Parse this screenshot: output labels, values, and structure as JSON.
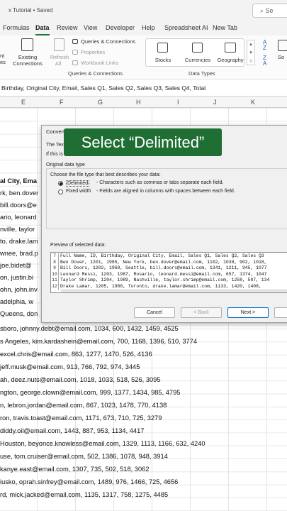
{
  "titlebar": {
    "title": "x Tutorial • Saved",
    "search_label": "Se"
  },
  "ribbon_tabs": [
    "Formulas",
    "Data",
    "Review",
    "View",
    "Developer",
    "Help",
    "Spreadsheet AI",
    "New Tab"
  ],
  "active_tab": "Data",
  "ribbon": {
    "left_cut_1": "nt",
    "left_cut_2": "es",
    "existing_connections": [
      "Existing",
      "Connections"
    ],
    "refresh": [
      "Refresh",
      "All"
    ],
    "queries_connections": "Queries & Connections",
    "properties": "Properties",
    "workbook_links": "Workbook Links",
    "group_queries": "Queries & Connections",
    "stocks": "Stocks",
    "currencies": "Currencies",
    "geography": "Geography",
    "group_datatypes": "Data Types",
    "sort_cut": "So"
  },
  "formula_bar": "Birthday,  Original City,  Email,  Sales Q1,  Sales Q2,  Sales Q3,  Sales Q4, Total",
  "column_headers": [
    "E",
    "F",
    "G",
    "H",
    "I",
    "J",
    "K"
  ],
  "rows": [
    "al City,  Ema",
    "rk, ben.dover",
    "bill.doors@e",
    "ario, leonard",
    "nville, taylor",
    "to, drake.lam",
    "wnee, brad.p",
    "joe.bidet@",
    "on, justin.bi",
    "ohn, john.inv",
    "adelphia, w",
    "Queens, don",
    "sboro, johnny.debt@email.com, 1034, 600, 1432, 1459, 4525",
    "s Angeles, kim.kardashein@email.com, 700, 1168, 1396, 510, 3774",
    "excel.chris@email.com, 863, 1277, 1470, 526, 4136",
    "jeff.musk@email.com, 913, 766, 792, 974, 3445",
    "ah, deez.nuts@email.com, 1018, 1033, 518, 526, 3095",
    "ngton, george.clown@email.com, 999, 1377, 1434, 985, 4795",
    "n, lebron.jordan@email.com, 867, 1023, 1478, 770, 4138",
    "ron, travis.toast@email.com, 1171, 673, 710, 725, 3279",
    "diddy.oil@email.com, 1443, 887, 953, 1134, 4417",
    "Houston, beyonce.knowless@email.com, 1329, 1113, 1166, 632, 4240",
    "use, tom.cruiser@email.com, 502, 1386, 1078, 948, 3914",
    "kanye.east@email.com, 1307, 735, 502, 518, 3062",
    "iusko, oprah.sinfrey@email.com, 1489, 976, 1466, 725, 4656",
    "rd, mick.jacked@email.com, 1135, 1317, 758, 1275, 4485"
  ],
  "dialog": {
    "title": "Convert",
    "line1": "The Text",
    "line2": "If this is c",
    "section": "Original data type",
    "choose_label": "Choose the file type that best describes your data:",
    "delimited_label": "Delimited",
    "delimited_desc": "- Characters such as commas or tabs separate each field.",
    "fixed_label": "Fixed width",
    "fixed_desc": "- Fields are aligned in columns with spaces between each field.",
    "preview_label": "Preview of selected data:",
    "preview_rows": [
      {
        "n": "7",
        "text": "Full Name,  ID, Birthday,  Original City,  Email, Sales Q1, Sales Q2, Sales Q3"
      },
      {
        "n": "8",
        "text": "Ben Dover, 1201, 1985,  New York,  ben.dover@email.com, 1102, 1038, 902, 1018,"
      },
      {
        "n": "9",
        "text": "Bill Doors, 1202, 1969,  Seattle,  bill.doors@email.com, 1341, 1211, 945, 1077"
      },
      {
        "n": "10",
        "text": "Leonard Messi, 1203, 1987,  Rosario,  leonard.messi@email.com, 657, 1374, 1047"
      },
      {
        "n": "11",
        "text": "Taylor Shrimp, 1204, 1989,  Nashville,  taylor.shrimp@email.com, 1258, 587, 134"
      },
      {
        "n": "12",
        "text": "Drake Lamar, 1205, 1986,  Toronto,  drake.lamar@email.com, 1133, 1420, 1408,"
      }
    ],
    "cancel": "Cancel",
    "back": "< Back",
    "next": "Next >"
  },
  "callout": "Select “Delimited”",
  "colors": {
    "excel_green": "#217346",
    "callout_bg": "#1f6e34",
    "dialog_bg": "#f0f0f0"
  }
}
